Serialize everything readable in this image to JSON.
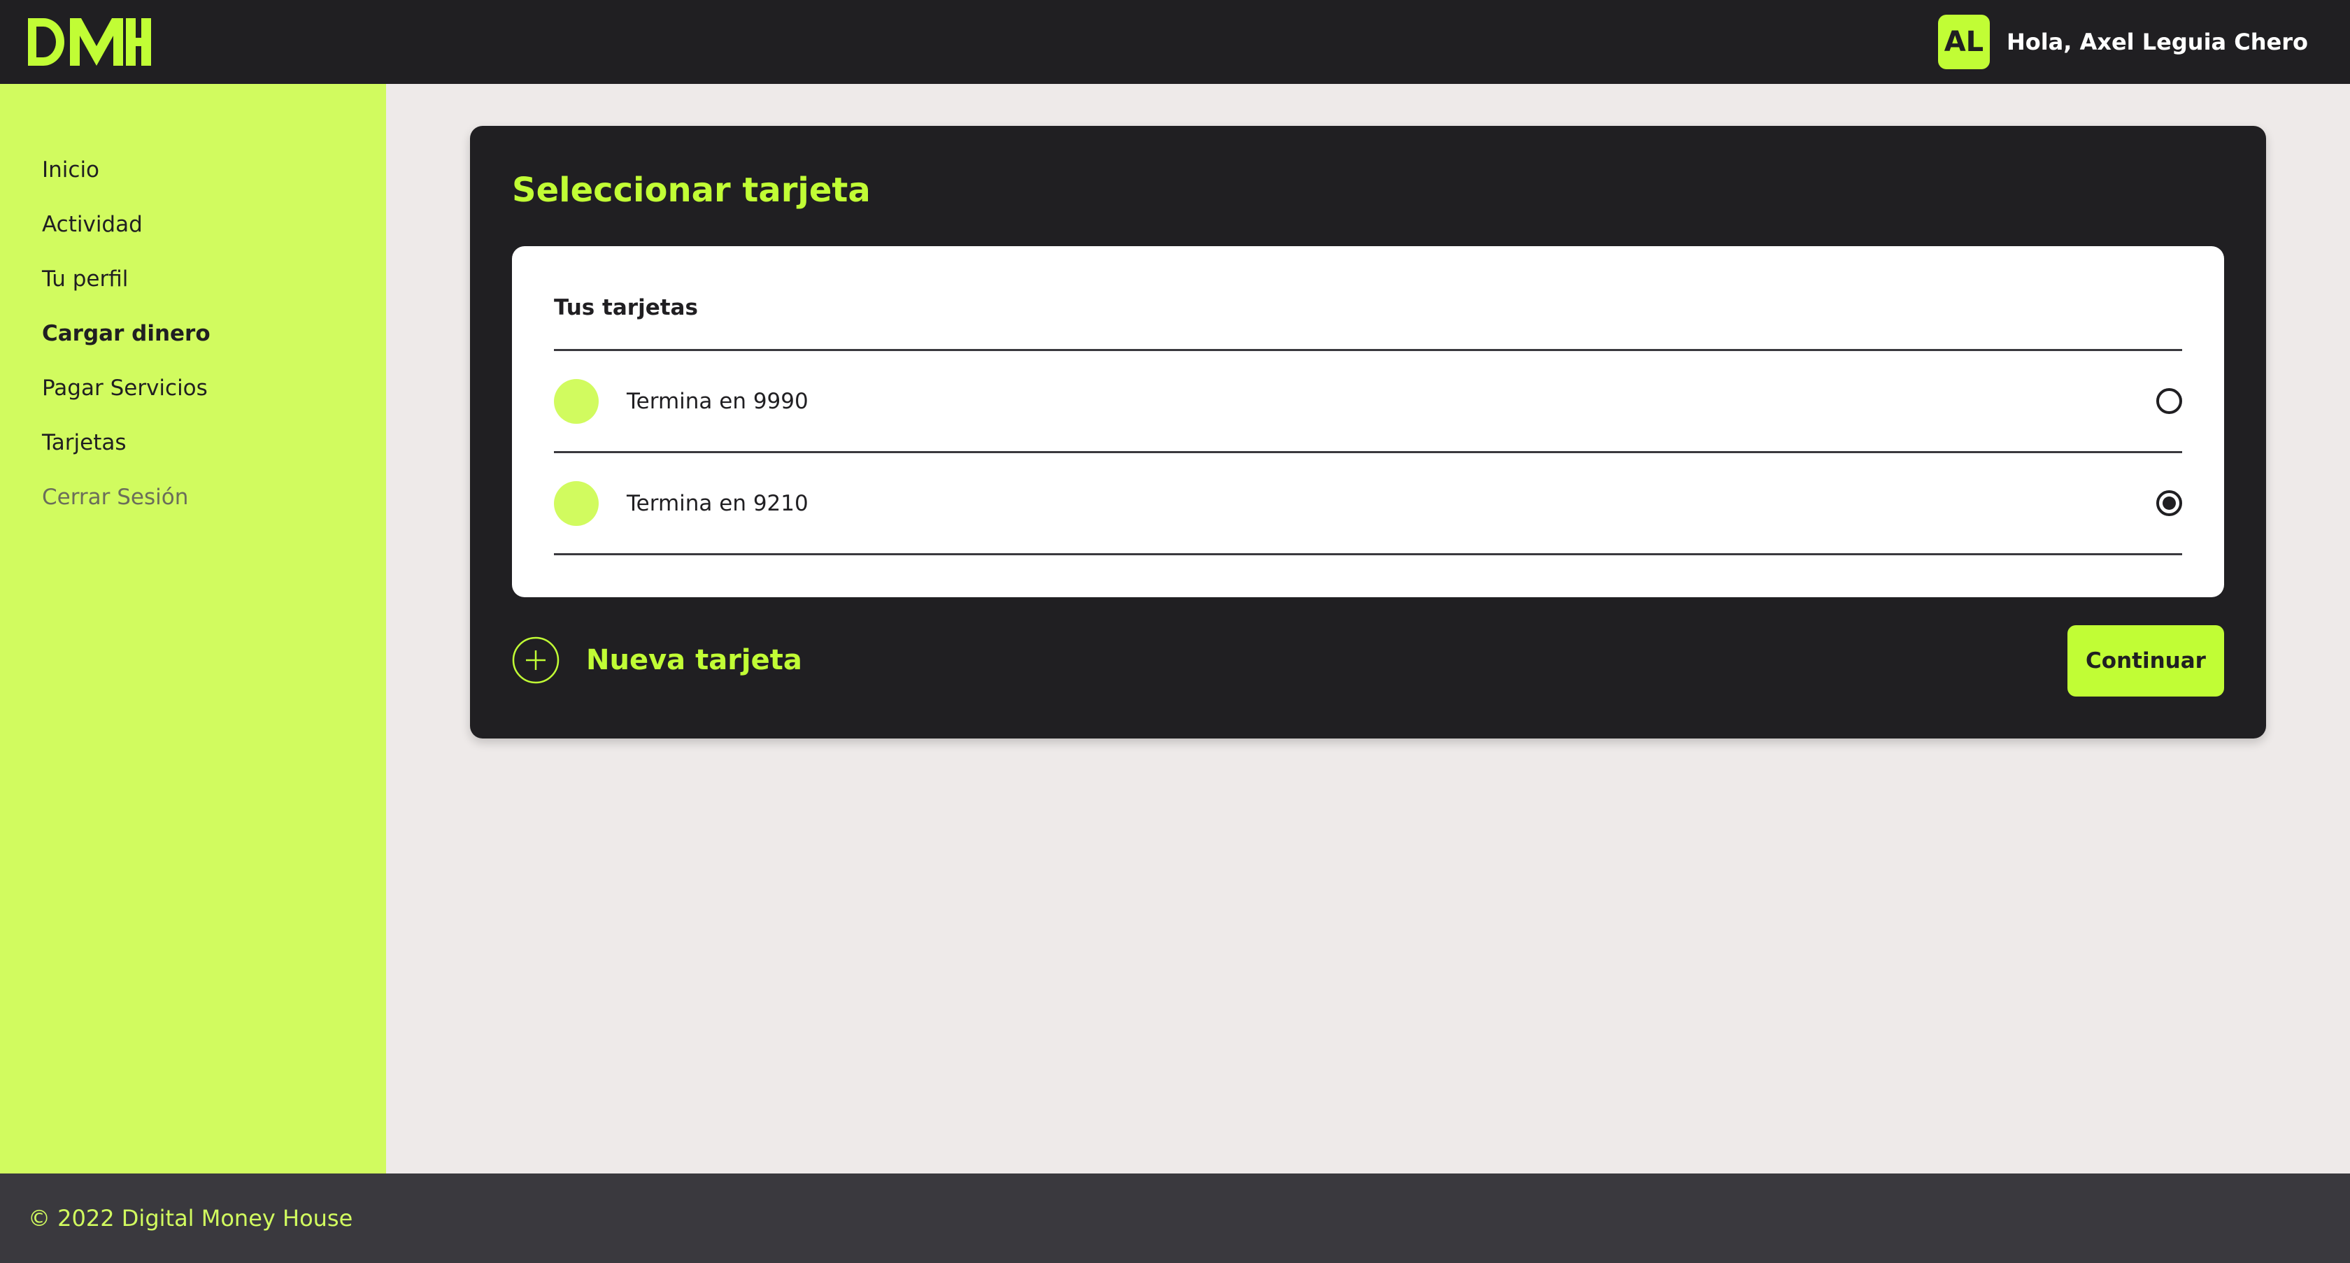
{
  "header": {
    "logo_icon": "dmh-logo-icon",
    "avatar_initials": "AL",
    "greeting": "Hola, Axel Leguia Chero"
  },
  "sidebar": {
    "items": [
      {
        "label": "Inicio"
      },
      {
        "label": "Actividad"
      },
      {
        "label": "Tu perfil"
      },
      {
        "label": "Cargar dinero",
        "active": true
      },
      {
        "label": "Pagar Servicios"
      },
      {
        "label": "Tarjetas"
      },
      {
        "label": "Cerrar Sesión"
      }
    ]
  },
  "main": {
    "title": "Seleccionar tarjeta",
    "cards_heading": "Tus tarjetas",
    "cards": [
      {
        "label": "Termina en 9990",
        "selected": false
      },
      {
        "label": "Termina en 9210",
        "selected": true
      }
    ],
    "new_card_icon": "plus-circle-icon",
    "new_card_label": "Nueva tarjeta",
    "continue_label": "Continuar"
  },
  "footer": {
    "text": "© 2022 Digital Money House"
  },
  "colors": {
    "accent": "#c1fd35",
    "sidebar_bg": "#d1fb5f",
    "dark": "#201f22",
    "footer_bg": "#3a393e",
    "page_bg": "#eeeae9"
  }
}
